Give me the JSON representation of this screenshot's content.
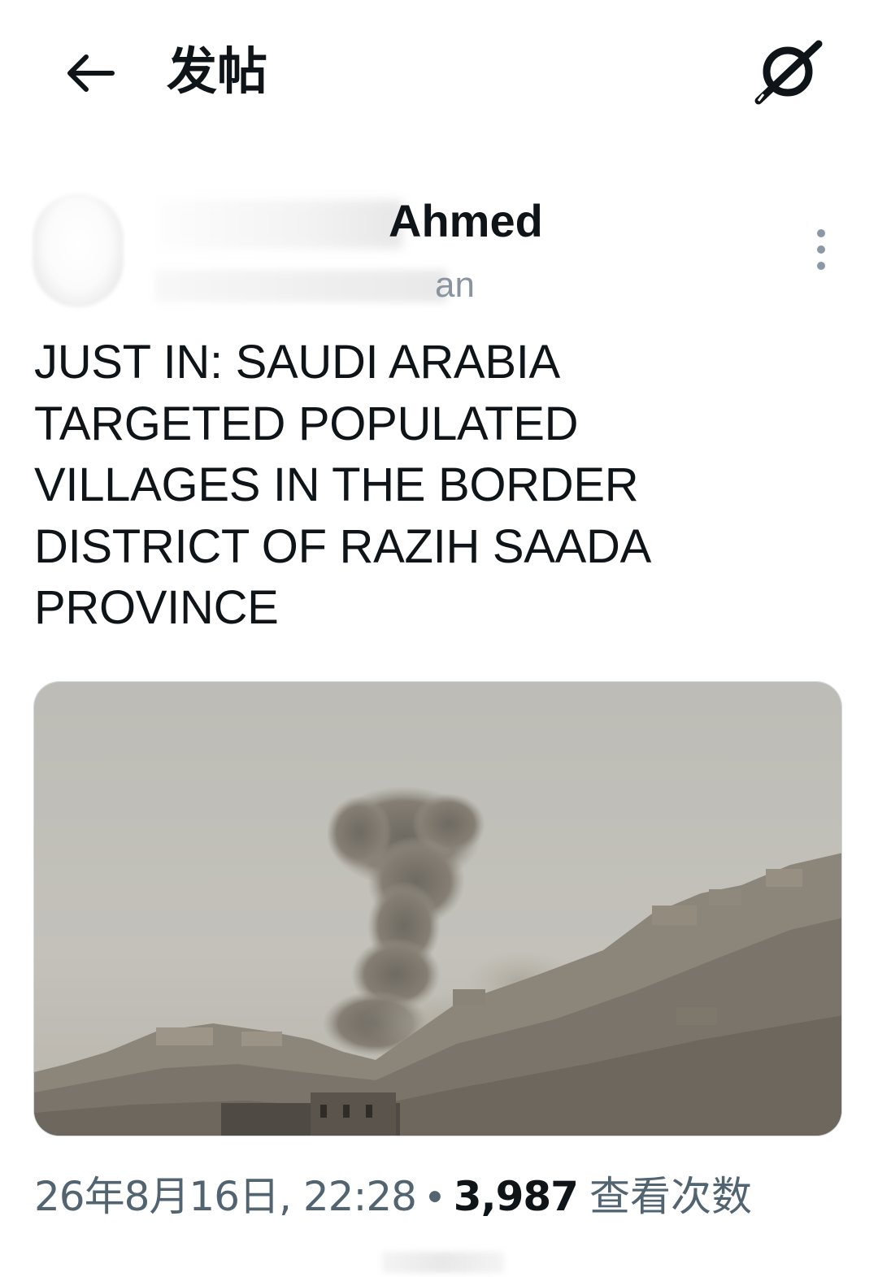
{
  "header": {
    "title": "发帖",
    "back_icon": "arrow-left-icon",
    "grok_icon": "grok-icon"
  },
  "author": {
    "display_name_visible": "Ahmed",
    "handle_visible": "an"
  },
  "tweet": {
    "text": "JUST IN: SAUDI ARABIA\nTARGETED POPULATED\nVILLAGES IN THE BORDER\nDISTRICT OF RAZIH SAADA\nPROVINCE"
  },
  "meta": {
    "timestamp": "26年8月16日, 22:28",
    "separator": "•",
    "views_count": "3,987",
    "views_label": "查看次数"
  },
  "colors": {
    "text_primary": "#0f1419",
    "text_secondary": "#536471",
    "more_dots": "#8b98a5"
  }
}
